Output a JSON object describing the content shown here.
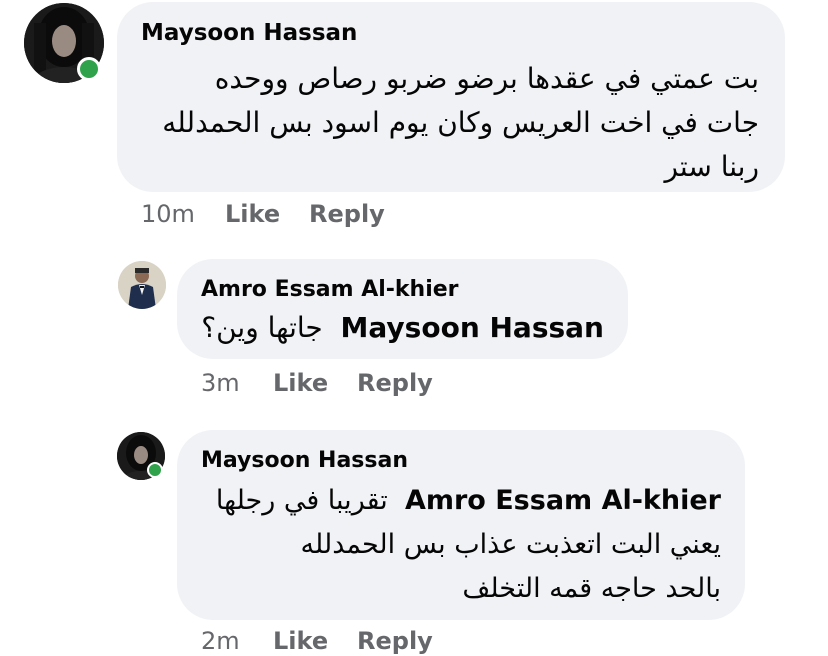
{
  "comments": [
    {
      "author": "Maysoon Hassan",
      "online": true,
      "lines": [
        "بت عمتي في عقدها برضو ضربو رصاص ووحده",
        "جات في اخت العريس وكان يوم اسود بس الحمدلله",
        "ربنا ستر"
      ],
      "time": "10m",
      "like_label": "Like",
      "reply_label": "Reply"
    },
    {
      "author": "Amro Essam Al-khier",
      "online": false,
      "mention": "Maysoon Hassan",
      "lines": [
        "جاتها وين؟"
      ],
      "time": "3m",
      "like_label": "Like",
      "reply_label": "Reply"
    },
    {
      "author": "Maysoon Hassan",
      "online": true,
      "mention": "Amro Essam Al-khier",
      "lines": [
        "تقريبا في رجلها",
        "يعني البت اتعذبت عذاب بس الحمدلله",
        "بالحد حاجه قمه التخلف"
      ],
      "time": "2m",
      "like_label": "Like",
      "reply_label": "Reply"
    }
  ],
  "colors": {
    "bubble": "#f0f2f5",
    "online": "#31a24c",
    "meta_text": "#65676b",
    "text": "#050505"
  }
}
